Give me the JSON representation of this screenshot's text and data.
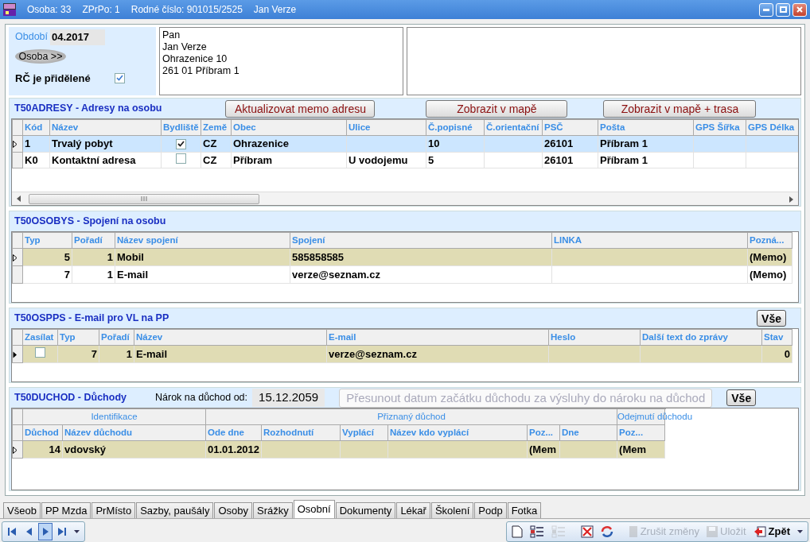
{
  "window": {
    "title_parts": [
      "Osoba: 33",
      "ZPrPo: 1",
      "Rodné číslo: 901015/2525",
      "Jan Verze"
    ]
  },
  "header": {
    "period_label": "Období",
    "period": "04.2017",
    "osoba_button": "Osoba >>",
    "rc_label": "RČ je přidělené",
    "rc_checked": true,
    "address_lines": [
      "Pan",
      "Jan Verze",
      "Ohrazenice 10",
      "261 01 Příbram 1"
    ]
  },
  "adresy": {
    "title": "T50ADRESY - Adresy na osobu",
    "buttons": [
      "Aktualizovat memo adresu",
      "Zobrazit v mapě",
      "Zobrazit v mapě + trasa"
    ],
    "columns": [
      "Kód",
      "Název",
      "Bydliště",
      "Země",
      "Obec",
      "Ulice",
      "Č.popisné",
      "Č.orientační",
      "PSČ",
      "Pošta",
      "GPS Šířka",
      "GPS Délka"
    ],
    "rows": [
      {
        "selected": true,
        "cells": [
          "1",
          "Trvalý pobyt",
          {
            "checked": true
          },
          "CZ",
          "Ohrazenice",
          "",
          "10",
          "",
          "26101",
          "Příbram 1",
          "",
          ""
        ]
      },
      {
        "selected": false,
        "cells": [
          "K0",
          "Kontaktní adresa",
          {
            "checked": false
          },
          "CZ",
          "Příbram",
          "U vodojemu",
          "5",
          "",
          "26101",
          "Příbram 1",
          "",
          ""
        ]
      }
    ]
  },
  "osobys": {
    "title": "T50OSOBYS - Spojení na osobu",
    "columns": [
      "Typ",
      "Pořadí",
      "Název spojení",
      "Spojení",
      "LINKA",
      "Pozná..."
    ],
    "rows": [
      {
        "selected": true,
        "cells": [
          "5",
          "1",
          "Mobil",
          "585858585",
          "",
          "(Memo)"
        ]
      },
      {
        "selected": false,
        "cells": [
          "7",
          "1",
          "E-mail",
          "verze@seznam.cz",
          "",
          "(Memo)"
        ]
      }
    ]
  },
  "ospps": {
    "title": "T50OSPPS - E-mail pro VL na PP",
    "all_button": "Vše",
    "columns": [
      "Zasílat",
      "Typ",
      "Pořadí",
      "Název",
      "E-mail",
      "Heslo",
      "Další text do zprávy",
      "Stav"
    ],
    "rows": [
      {
        "selected": true,
        "cells": [
          {
            "checked": false
          },
          "7",
          "1",
          "E-mail",
          "verze@seznam.cz",
          "",
          "",
          "0"
        ]
      }
    ]
  },
  "duchod": {
    "title": "T50DUCHOD - Důchody",
    "claim_label": "Nárok na důchod od:",
    "claim_date": "15.12.2059",
    "move_button": {
      "label": "Přesunout datum začátku důchodu za výsluhy do nároku na důchod",
      "disabled": true
    },
    "all_button": "Vše",
    "column_groups": [
      {
        "label": "Identifikace"
      },
      {
        "label": "Přiznaný důchod"
      },
      {
        "label": "Odejmutí důchodu"
      }
    ],
    "columns": [
      "Důchod",
      "Název důchodu",
      "Ode dne",
      "Rozhodnutí",
      "Vyplácí",
      "Název kdo vyplácí",
      "Poz...",
      "Dne",
      "Poz..."
    ],
    "rows": [
      {
        "selected": true,
        "cells": [
          "14",
          "vdovský",
          "01.01.2012",
          "",
          "",
          "",
          "(Mem",
          "",
          "(Mem"
        ]
      }
    ]
  },
  "tabs": [
    {
      "label": "Všeob",
      "selected": false
    },
    {
      "label": "PP Mzda",
      "selected": false
    },
    {
      "label": "PrMísto",
      "selected": false
    },
    {
      "label": "Sazby, paušály",
      "selected": false
    },
    {
      "label": "Osoby",
      "selected": false
    },
    {
      "label": "Srážky",
      "selected": false
    },
    {
      "label": "Osobní",
      "selected": true
    },
    {
      "label": "Dokumenty",
      "selected": false
    },
    {
      "label": "Lékař",
      "selected": false
    },
    {
      "label": "Školení",
      "selected": false
    },
    {
      "label": "Podp",
      "selected": false
    },
    {
      "label": "Fotka",
      "selected": false
    }
  ],
  "navigator": [
    {
      "kind": "first",
      "selected": false
    },
    {
      "kind": "prev",
      "selected": false
    },
    {
      "kind": "next",
      "selected": true
    },
    {
      "kind": "last",
      "selected": false
    }
  ],
  "toolbar": [
    {
      "kind": "new",
      "disabled": false
    },
    {
      "kind": "list",
      "disabled": false
    },
    {
      "kind": "list",
      "disabled": true
    },
    {
      "kind": "delete",
      "disabled": false
    },
    {
      "kind": "refresh",
      "disabled": false
    },
    {
      "kind": "cancel",
      "label": "Zrušit změny",
      "disabled": true
    },
    {
      "kind": "save",
      "label": "Uložit",
      "disabled": true
    },
    {
      "kind": "back",
      "label": "Zpět",
      "disabled": false
    }
  ]
}
